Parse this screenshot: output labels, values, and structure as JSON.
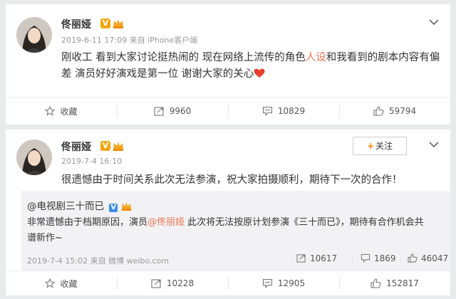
{
  "posts": [
    {
      "author": "佟丽娅",
      "badge": "V",
      "meta": "2019-6-11 17:09  来自 iPhone客户端",
      "content_before": "刚收工  看到大家讨论挺热闹的  现在网络上流传的角色",
      "content_highlight": "人设",
      "content_after": "和我看到的剧本内容有偏差  演员好好演戏是第一位  谢谢大家的关心",
      "actions": {
        "favorite": "收藏",
        "repost": "9960",
        "comment": "10829",
        "like": "59794"
      }
    },
    {
      "author": "佟丽娅",
      "badge": "V",
      "meta": "2019-7-4 16:10",
      "follow_label": "关注",
      "content": "很遗憾由于时间关系此次无法参演，祝大家拍摄顺利，期待下一次的合作！",
      "repost": {
        "user": "@电视剧三十而已",
        "badge": "V",
        "text_before": "非常遗憾由于档期原因，演员",
        "text_mention": "@佟丽娅",
        "text_after": " 此次将无法按原计划参演《三十而已》，期待有合作机会共谱新作~",
        "meta": "2019-7-4 15:02  来自 微博 weibo.com",
        "stats": {
          "repost": "10617",
          "comment": "1869",
          "like": "46047"
        }
      },
      "actions": {
        "favorite": "收藏",
        "repost": "10228",
        "comment": "12905",
        "like": "152817"
      }
    }
  ],
  "colors": {
    "highlight": "#eb7350",
    "badge": "#f2a60c",
    "heart": "#e8402c"
  }
}
